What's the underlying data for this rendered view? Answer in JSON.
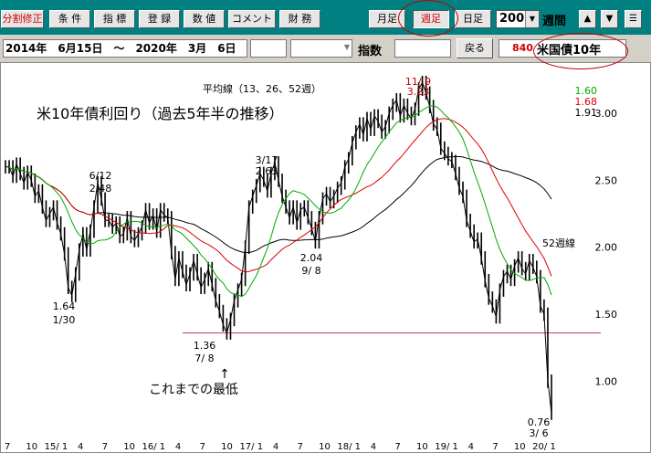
{
  "toolbar": {
    "buttons": [
      {
        "label": "分割修正",
        "red": true
      },
      {
        "label": "条 件"
      },
      {
        "label": "指 標"
      },
      {
        "label": "登 録"
      },
      {
        "label": "数 値"
      },
      {
        "label": "コメント"
      },
      {
        "label": "財 務"
      },
      {
        "label": "月足"
      },
      {
        "label": "週足",
        "red": true,
        "active": true
      },
      {
        "label": "日足"
      }
    ],
    "period_value": "200",
    "period_label": "週間",
    "up_label": "▲",
    "down_label": "▼",
    "menu_label": "☰"
  },
  "infobar": {
    "date_range": "2014年　6月15日　〜　2020年　3月　6日",
    "index_label": "指数",
    "back_label": "戻る",
    "code": "840",
    "name": "米国債10年"
  },
  "colors": {
    "toolbar": "#008080",
    "ma13": "#00aa00",
    "ma26": "#dd0000",
    "ma52": "#000000",
    "floor": "#c04060",
    "price": "#000000"
  },
  "chart_data": {
    "type": "line",
    "title": "米10年債利回り（過去5年半の推移）",
    "subtitle": "平均線（13、26、52週）",
    "y_ticks": [
      "3.00",
      "2.50",
      "2.00",
      "1.50",
      "1.00"
    ],
    "ylim": [
      0.6,
      3.3
    ],
    "x_tick_labels": [
      "7",
      "10",
      "15/ 1",
      "4",
      "7",
      "10",
      "16/ 1",
      "4",
      "7",
      "10",
      "17/ 1",
      "4",
      "7",
      "10",
      "18/ 1",
      "4",
      "7",
      "10",
      "19/ 1",
      "4",
      "7",
      "10",
      "20/ 1"
    ],
    "ma_legend": [
      {
        "value": "1.60",
        "series": "ma13"
      },
      {
        "value": "1.68",
        "series": "ma26"
      },
      {
        "value": "1.91",
        "series": "ma52"
      }
    ],
    "ma52_label": "52週線",
    "floor_value": 1.36,
    "floor_note": "これまでの最低",
    "floor_arrow": "↑",
    "annotations": [
      {
        "date": "6/12",
        "value": "2.48",
        "anchor": "above"
      },
      {
        "date": "1/30",
        "value": "1.64",
        "anchor": "below"
      },
      {
        "date": "7/ 8",
        "value": "1.36",
        "anchor": "below"
      },
      {
        "date": "3/17",
        "value": "2.63",
        "anchor": "above"
      },
      {
        "date": "9/ 8",
        "value": "2.04",
        "anchor": "below"
      },
      {
        "date": "11/ 9",
        "value": "3.23",
        "anchor": "above",
        "red": true
      },
      {
        "date": "3/ 6",
        "value": "0.76",
        "anchor": "below"
      }
    ],
    "price_weekly": [
      2.6,
      2.6,
      2.53,
      2.62,
      2.55,
      2.48,
      2.56,
      2.5,
      2.38,
      2.42,
      2.3,
      2.2,
      2.25,
      2.3,
      2.18,
      2.1,
      1.95,
      1.7,
      1.64,
      1.8,
      1.98,
      2.1,
      1.98,
      2.12,
      2.3,
      2.48,
      2.36,
      2.2,
      2.2,
      2.15,
      2.18,
      2.08,
      2.1,
      2.22,
      2.08,
      2.05,
      2.1,
      2.15,
      2.28,
      2.18,
      2.24,
      2.12,
      2.28,
      2.24,
      2.22,
      1.96,
      1.76,
      1.92,
      1.82,
      1.72,
      1.8,
      1.9,
      1.8,
      1.7,
      1.76,
      1.84,
      1.72,
      1.6,
      1.52,
      1.42,
      1.36,
      1.46,
      1.6,
      1.68,
      1.76,
      2.0,
      2.3,
      2.38,
      2.46,
      2.55,
      2.5,
      2.42,
      2.55,
      2.63,
      2.5,
      2.38,
      2.3,
      2.22,
      2.3,
      2.18,
      2.28,
      2.3,
      2.22,
      2.14,
      2.04,
      2.22,
      2.36,
      2.4,
      2.34,
      2.38,
      2.44,
      2.48,
      2.6,
      2.66,
      2.78,
      2.86,
      2.92,
      2.84,
      2.96,
      2.88,
      2.98,
      2.94,
      2.86,
      2.9,
      3.0,
      3.06,
      3.1,
      2.98,
      3.06,
      3.0,
      2.96,
      3.03,
      3.18,
      3.23,
      3.15,
      3.05,
      2.92,
      2.88,
      2.74,
      2.7,
      2.66,
      2.64,
      2.55,
      2.44,
      2.38,
      2.2,
      2.12,
      2.04,
      2.06,
      1.92,
      1.75,
      1.62,
      1.56,
      1.48,
      1.68,
      1.78,
      1.82,
      1.76,
      1.86,
      1.92,
      1.84,
      1.8,
      1.9,
      1.85,
      1.78,
      1.56,
      1.5,
      1.0,
      0.76
    ]
  }
}
